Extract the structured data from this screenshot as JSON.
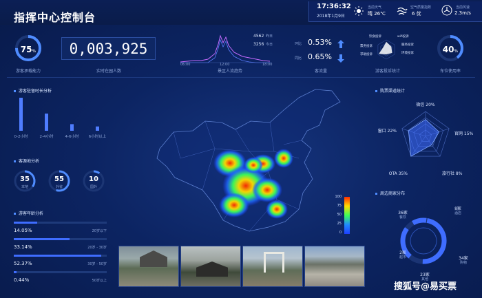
{
  "header": {
    "title": "指挥中心控制台",
    "time": "17:36:32",
    "date": "2018年1月9日",
    "weather_label": "当前天气",
    "weather": "晴 26℃",
    "air_label": "空气质量指数",
    "air": "6 优",
    "wind_label": "当前风速",
    "wind": "2.3m/s"
  },
  "top": {
    "capacity": {
      "value": "75",
      "pct": "%",
      "label": "游客承载能力",
      "fill": 0.75
    },
    "counter": {
      "value": "0,003,925",
      "label": "实时在园人数"
    },
    "trend": {
      "label": "景区人流趋势",
      "x_ticks": [
        "06:00",
        "12:00",
        "18:00"
      ],
      "series": [
        {
          "value": "4562",
          "name": "昨日"
        },
        {
          "value": "3256",
          "name": "今日"
        }
      ]
    },
    "flow": {
      "label": "客流量",
      "hb_label": "环比",
      "hb_value": "0.53%",
      "tb_label": "同比",
      "tb_value": "0.65%"
    },
    "complaint": {
      "label": "游客投诉统计",
      "axes": [
        "饮食投诉",
        "wifi投诉",
        "服务投诉",
        "环境投诉",
        "求助投诉",
        "票务投诉"
      ]
    },
    "parking": {
      "value": "40",
      "pct": "%",
      "label": "车位使用率",
      "fill": 0.4
    }
  },
  "left": {
    "stay": {
      "title": "游客驻留时长分析",
      "bars": [
        {
          "label": "0-2小时",
          "value": 100
        },
        {
          "label": "2-4小时",
          "value": 52
        },
        {
          "label": "4-6小时",
          "value": 20
        },
        {
          "label": "6小时以上",
          "value": 13
        }
      ]
    },
    "source": {
      "title": "客源地分析",
      "items": [
        {
          "value": "35",
          "label": "本地",
          "fill": 0.35
        },
        {
          "value": "55",
          "label": "外省",
          "fill": 0.55
        },
        {
          "value": "10",
          "label": "国外",
          "fill": 0.1
        }
      ]
    },
    "age": {
      "title": "游客年龄分析",
      "items": [
        {
          "value": "14.05%",
          "range": "20岁以下",
          "pct": 14.05
        },
        {
          "value": "33.14%",
          "range": "20岁 - 30岁",
          "pct": 33.14
        },
        {
          "value": "52.37%",
          "range": "30岁 - 50岁",
          "pct": 52.37
        },
        {
          "value": "0.44%",
          "range": "50岁以上",
          "pct": 0.44
        }
      ]
    }
  },
  "heatmap": {
    "scale": [
      "100",
      "75",
      "50",
      "25",
      "0"
    ]
  },
  "right": {
    "channel": {
      "title": "购票渠道统计",
      "items": [
        {
          "label": "微信 20%",
          "value": 20
        },
        {
          "label": "官网 15%",
          "value": 15
        },
        {
          "label": "旅行社 8%",
          "value": 8
        },
        {
          "label": "OTA 35%",
          "value": 35
        },
        {
          "label": "窗口 22%",
          "value": 22
        }
      ]
    },
    "shops": {
      "title": "周边商家分布",
      "items": [
        {
          "count": "36家",
          "type": "餐饮"
        },
        {
          "count": "8家",
          "type": "酒店"
        },
        {
          "count": "2家",
          "type": "超市"
        },
        {
          "count": "34家",
          "type": "购物"
        },
        {
          "count": "23家",
          "type": "其他"
        }
      ]
    }
  },
  "watermark": "搜狐号@易买票",
  "colors": {
    "accent": "#3f6dff",
    "bg": "#0a1c4a",
    "text": "#cfe0ff"
  }
}
